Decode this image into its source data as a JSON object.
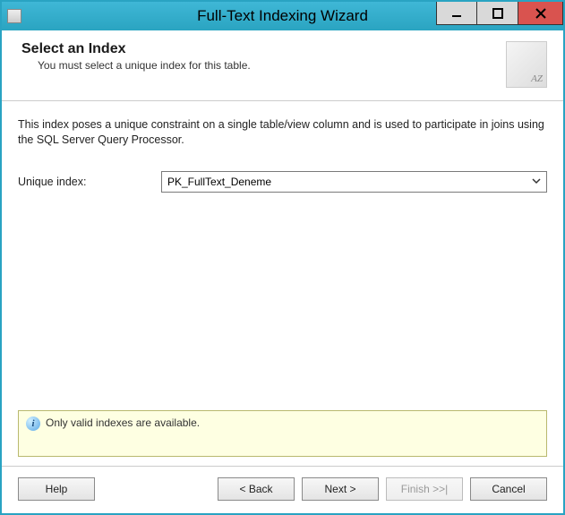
{
  "window": {
    "title": "Full-Text Indexing Wizard"
  },
  "header": {
    "title": "Select an Index",
    "subtitle": "You must select a unique index for this table.",
    "graphic_label": "AZ"
  },
  "body": {
    "description": "This index poses a unique constraint on a single table/view column and is used to participate in joins using the SQL Server Query Processor.",
    "unique_index_label": "Unique index:",
    "unique_index_value": "PK_FullText_Deneme"
  },
  "info": {
    "text": "Only valid indexes are available."
  },
  "buttons": {
    "help": "Help",
    "back": "< Back",
    "next": "Next >",
    "finish": "Finish >>|",
    "cancel": "Cancel"
  }
}
